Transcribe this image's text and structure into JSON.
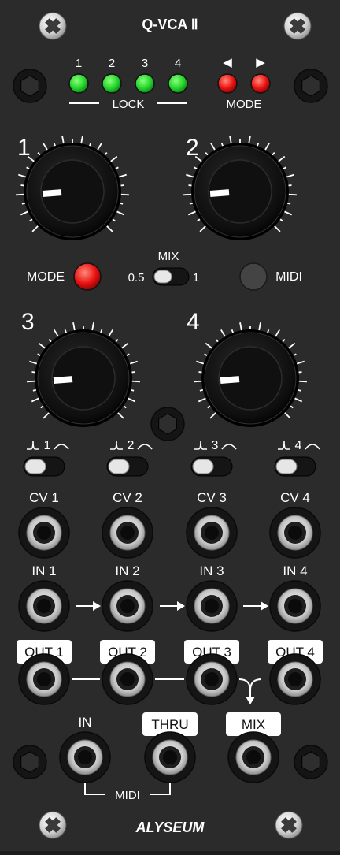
{
  "module": {
    "title": "Q-VCA Ⅱ",
    "brand": "ALYSEUM"
  },
  "leds": {
    "lock_numbers": [
      "1",
      "2",
      "3",
      "4"
    ],
    "lock_label": "LOCK",
    "mode_arrows": [
      "◀",
      "▶"
    ],
    "mode_label": "MODE",
    "lock_color": "#22d42a",
    "mode_color": "#e81010"
  },
  "knobs": {
    "labels": [
      "1",
      "2",
      "3",
      "4"
    ],
    "pointer_levels": [
      0.15,
      0.15,
      0.15,
      0.15
    ]
  },
  "controls": {
    "mode_label": "MODE",
    "mode_button_color": "#ee1111",
    "mix_label": "MIX",
    "mix_left": "0.5",
    "mix_right": "1",
    "midi_label": "MIDI"
  },
  "curve_switches": {
    "labels": [
      "1",
      "2",
      "3",
      "4"
    ]
  },
  "jacks": {
    "cv": [
      "CV 1",
      "CV 2",
      "CV 3",
      "CV 4"
    ],
    "in": [
      "IN 1",
      "IN 2",
      "IN 3",
      "IN 4"
    ],
    "out": [
      "OUT 1",
      "OUT 2",
      "OUT 3",
      "OUT 4"
    ],
    "midi_in": "IN",
    "midi_thru": "THRU",
    "mix_out": "MIX",
    "midi_group": "MIDI"
  },
  "icons": [
    "phillips-screw-icon",
    "hex-standoff-icon",
    "arrow-right-icon",
    "exp-curve-icon",
    "log-curve-icon"
  ]
}
